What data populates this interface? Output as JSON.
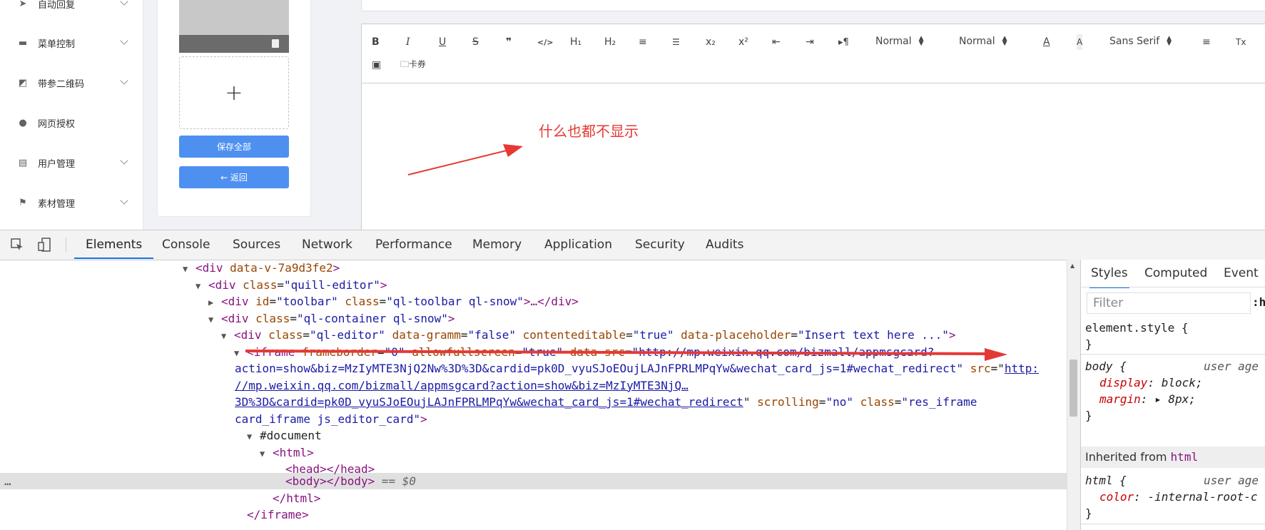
{
  "sidebar": {
    "items": [
      {
        "label": "自动回复",
        "icon": "send-icon"
      },
      {
        "label": "菜单控制",
        "icon": "menu-pin-icon"
      },
      {
        "label": "带参二维码",
        "icon": "chart-icon"
      },
      {
        "label": "网页授权",
        "icon": "user-icon"
      },
      {
        "label": "用户管理",
        "icon": "id-card-icon"
      },
      {
        "label": "素材管理",
        "icon": "flag-icon"
      }
    ]
  },
  "card_panel": {
    "uploader_symbol": "+",
    "save_all_label": "保存全部",
    "back_label": "← 返回"
  },
  "editor": {
    "toolbar": {
      "bold": "B",
      "italic": "I",
      "underline": "U",
      "strike": "S",
      "blockquote": "❞",
      "code": "</>",
      "h1": "H₁",
      "h2": "H₂",
      "ordered": "≡",
      "bullet": "☰",
      "sub": "x₂",
      "super": "x²",
      "outdent": "⇤",
      "indent": "⇥",
      "rtl": "▸¶",
      "size_1": "Normal",
      "size_2": "Normal",
      "color": "A",
      "background": "A",
      "font": "Sans Serif",
      "align": "≡",
      "clean": "Tx",
      "video": "▣",
      "card_label": "🗀卡券"
    },
    "annotation": "什么也都不显示"
  },
  "devtools": {
    "tabs": [
      "Elements",
      "Console",
      "Sources",
      "Network",
      "Performance",
      "Memory",
      "Application",
      "Security",
      "Audits"
    ],
    "active_tab": "Elements",
    "dom_lines": {
      "l1_tag": "<div",
      "l1_attr": " data-v-7a9d3fe2",
      "l1_end": ">",
      "l2_tag": "<div",
      "l2_attr": " class",
      "l2_val": "\"quill-editor\"",
      "l2_end": ">",
      "l3_tag": "<div",
      "l3_attr1": " id",
      "l3_val1": "\"toolbar\"",
      "l3_attr2": " class",
      "l3_val2": "\"ql-toolbar ql-snow\"",
      "l3_end": ">…</div>",
      "l4_tag": "<div",
      "l4_attr": " class",
      "l4_val": "\"ql-container ql-snow\"",
      "l4_end": ">",
      "l5_tag": "<div",
      "l5_attr1": " class",
      "l5_val1": "\"ql-editor\"",
      "l5_attr2": " data-gramm",
      "l5_val2": "\"false\"",
      "l5_attr3": " contenteditable",
      "l5_val3": "\"true\"",
      "l5_attr4": " data-placeholder",
      "l5_val4": "\"Insert text here ...\"",
      "l5_end": ">",
      "l6_tag": "<iframe",
      "l6_attr1": " frameborder",
      "l6_val1": "\"0\"",
      "l6_attr2": " allowfullscreen",
      "l6_val2": "\"true\"",
      "l6_attr3": " data-src",
      "l6_val3": "\"http://mp.weixin.qq.com/bizmall/appmsgcard?",
      "l7_val": "action=show&biz=MzIyMTE3NjQ2Nw%3D%3D&cardid=pk0D_vyuSJoEOujLAJnFPRLMPqYw&wechat_card_js=1#wechat_redirect\"",
      "l7_attr": " src",
      "l7_link": "http:",
      "l8_link": "//mp.weixin.qq.com/bizmall/appmsgcard?action=show&biz=MzIyMTE3NjQ…",
      "l9_link": "3D%3D&cardid=pk0D_vyuSJoEOujLAJnFPRLMPqYw&wechat_card_js=1#wechat_redirect",
      "l9_attr": " scrolling",
      "l9_val": "\"no\"",
      "l9_attr2": " class",
      "l9_val2": "\"res_iframe",
      "l10_val": "card_iframe js_editor_card\"",
      "l10_end": ">",
      "l11": "#document",
      "l12": "<html>",
      "l13": "<head></head>",
      "l14": "<body></body>",
      "l14_suffix": " == $0",
      "l15": "</html>",
      "l16": "</iframe>",
      "ellipsis": "…"
    },
    "styles_panel": {
      "tabs": [
        "Styles",
        "Computed",
        "Event L"
      ],
      "filter_placeholder": "Filter",
      "hov": ":h",
      "element_style": "element.style {",
      "close_brace": "}",
      "body_selector": "body {",
      "user_agent": "user age",
      "display_prop": "display",
      "display_val": ": block;",
      "margin_prop": "margin",
      "margin_val": ": ▸ 8px;",
      "inherited_label": "Inherited from ",
      "inherited_tag": "html",
      "html_selector": "html {",
      "color_prop": "color",
      "color_val": ": -internal-root-c"
    }
  },
  "colors": {
    "primary_button": "#4d90f0",
    "annotation_red": "#e53935",
    "tab_active": "#1a73e8"
  }
}
